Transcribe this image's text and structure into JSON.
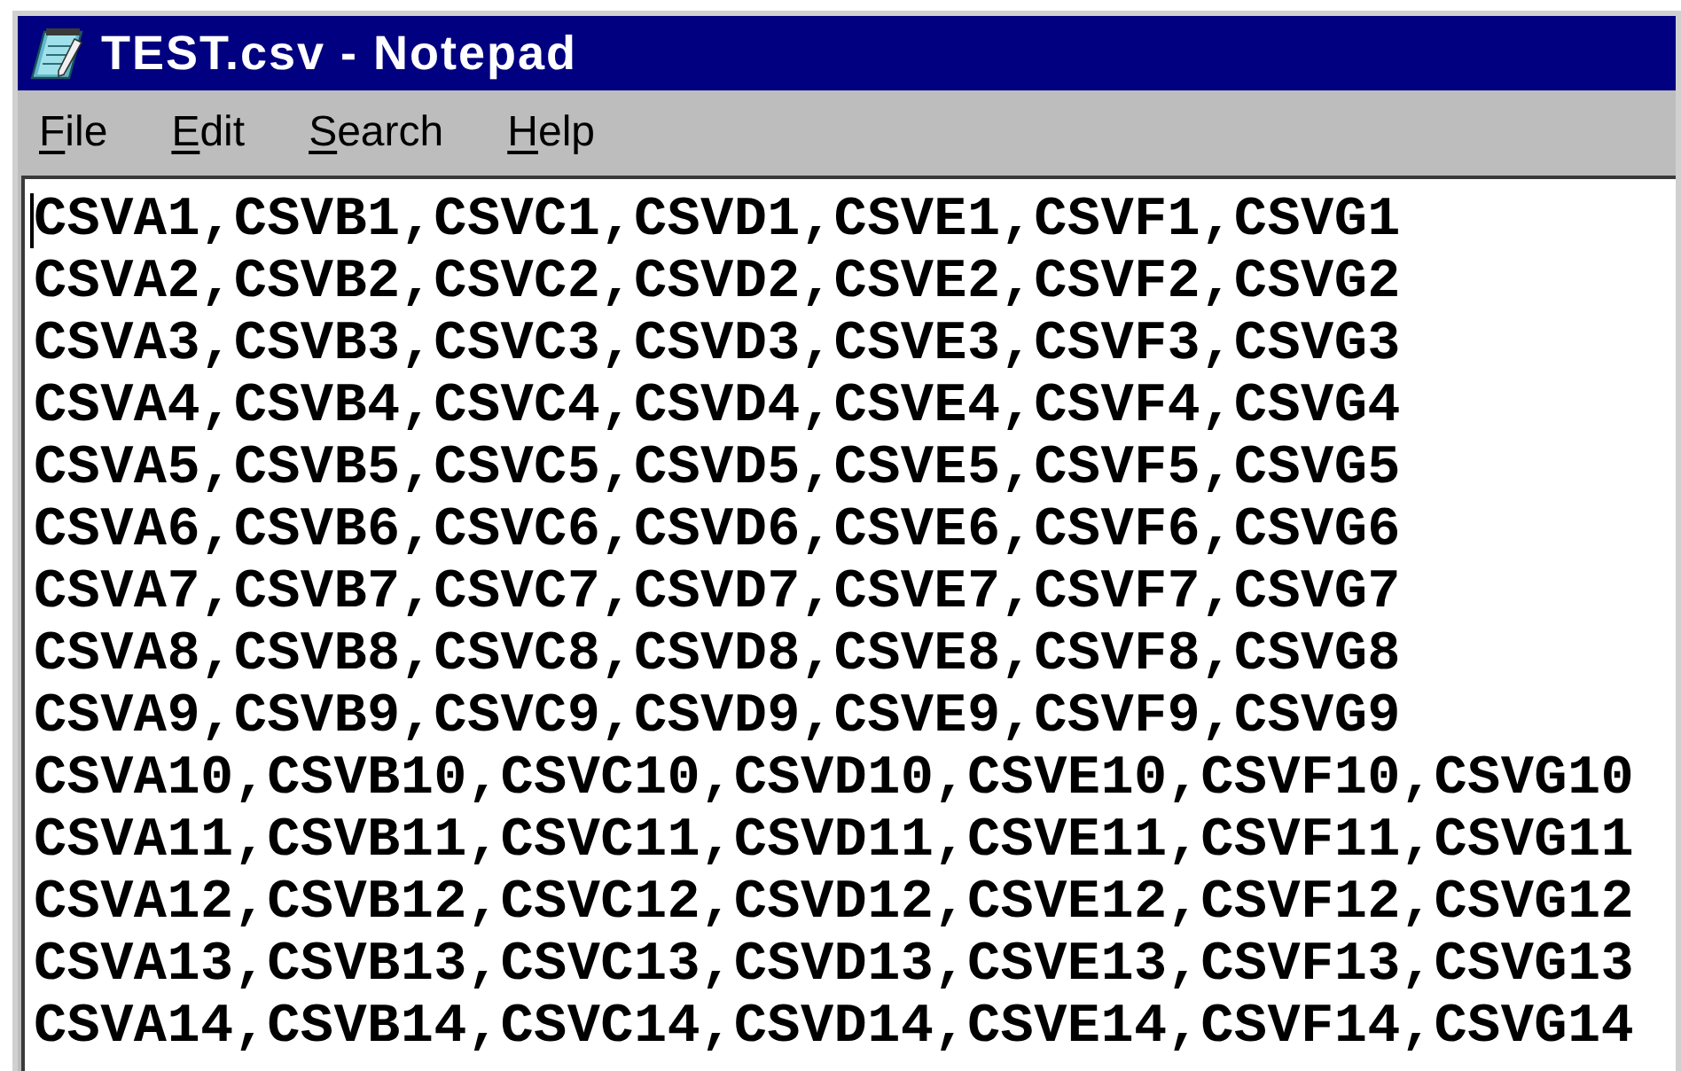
{
  "window": {
    "title": "TEST.csv - Notepad"
  },
  "menu": [
    "File",
    "Edit",
    "Search",
    "Help"
  ],
  "editor": {
    "lines": [
      {
        "text": "CSVA1,CSVB1,CSVC1,CSVD1,CSVE1,CSVF1,CSVG1",
        "caret": true
      },
      {
        "text": "CSVA2,CSVB2,CSVC2,CSVD2,CSVE2,CSVF2,CSVG2",
        "caret": false
      },
      {
        "text": "CSVA3,CSVB3,CSVC3,CSVD3,CSVE3,CSVF3,CSVG3",
        "caret": false
      },
      {
        "text": "CSVA4,CSVB4,CSVC4,CSVD4,CSVE4,CSVF4,CSVG4",
        "caret": false
      },
      {
        "text": "CSVA5,CSVB5,CSVC5,CSVD5,CSVE5,CSVF5,CSVG5",
        "caret": false
      },
      {
        "text": "CSVA6,CSVB6,CSVC6,CSVD6,CSVE6,CSVF6,CSVG6",
        "caret": false
      },
      {
        "text": "CSVA7,CSVB7,CSVC7,CSVD7,CSVE7,CSVF7,CSVG7",
        "caret": false
      },
      {
        "text": "CSVA8,CSVB8,CSVC8,CSVD8,CSVE8,CSVF8,CSVG8",
        "caret": false
      },
      {
        "text": "CSVA9,CSVB9,CSVC9,CSVD9,CSVE9,CSVF9,CSVG9",
        "caret": false
      },
      {
        "text": "CSVA10,CSVB10,CSVC10,CSVD10,CSVE10,CSVF10,CSVG10",
        "caret": false
      },
      {
        "text": "CSVA11,CSVB11,CSVC11,CSVD11,CSVE11,CSVF11,CSVG11",
        "caret": false
      },
      {
        "text": "CSVA12,CSVB12,CSVC12,CSVD12,CSVE12,CSVF12,CSVG12",
        "caret": false
      },
      {
        "text": "CSVA13,CSVB13,CSVC13,CSVD13,CSVE13,CSVF13,CSVG13",
        "caret": false
      },
      {
        "text": "CSVA14,CSVB14,CSVC14,CSVD14,CSVE14,CSVF14,CSVG14",
        "caret": false
      }
    ]
  }
}
